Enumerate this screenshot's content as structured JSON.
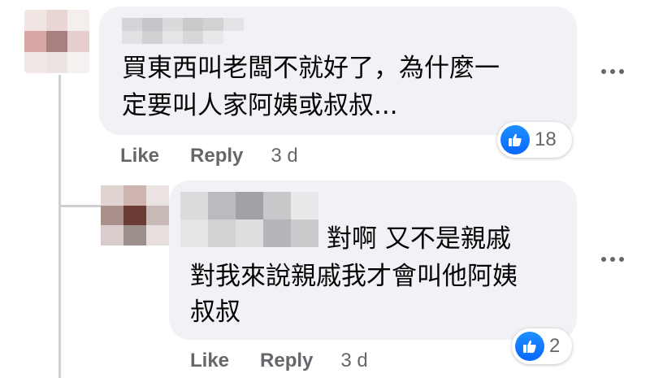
{
  "comment1": {
    "text_line1": "買東西叫老闆不就好了，為什麼一",
    "text_line2": "定要叫人家阿姨或叔叔...",
    "reaction_count": "18",
    "like_label": "Like",
    "reply_label": "Reply",
    "time": "3 d"
  },
  "comment2": {
    "text_line1": "對啊 又不是親戚",
    "text_line2": "對我來說親戚我才會叫他阿姨",
    "text_line3": "叔叔",
    "reaction_count": "2",
    "like_label": "Like",
    "reply_label": "Reply",
    "time": "3 d"
  },
  "colors": {
    "bubble_bg": "#f0f2f5",
    "meta_text": "#65676b",
    "like_blue": "#0866ff"
  },
  "icons": [
    "avatar-blurred",
    "like-reaction-icon",
    "more-options-icon"
  ]
}
